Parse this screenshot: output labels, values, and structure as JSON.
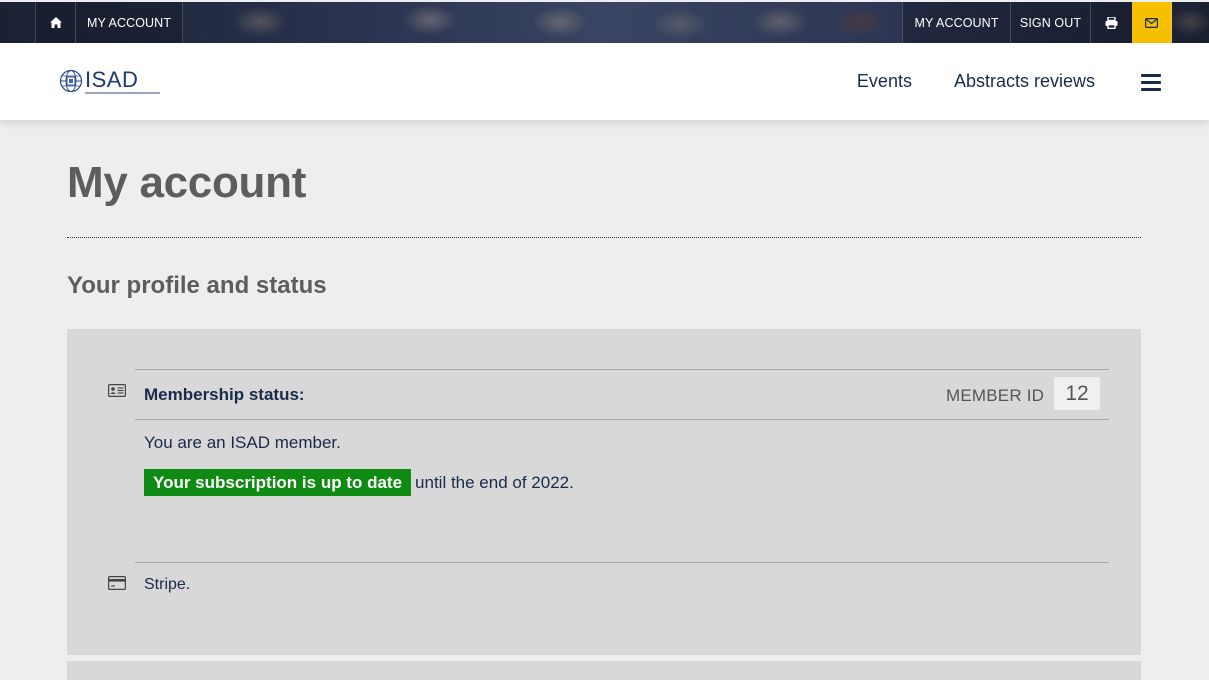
{
  "topbar": {
    "home_icon": "home-icon",
    "left_label": "MY ACCOUNT",
    "my_account": "MY ACCOUNT",
    "sign_out": "SIGN OUT",
    "print_icon": "print-icon",
    "mail_icon": "mail-icon",
    "mail_bg": "#f6c000"
  },
  "header": {
    "logo_text": "ISAD",
    "nav": [
      "Events",
      "Abstracts reviews"
    ],
    "menu_icon": "hamburger-icon"
  },
  "page": {
    "title": "My account",
    "section_title": "Your profile and status"
  },
  "membership": {
    "icon": "id-card-icon",
    "status_label": "Membership status:",
    "member_id_label": "MEMBER ID",
    "member_id": "12",
    "member_text": "You are an ISAD member.",
    "subscription_badge": "Your subscription is up to date",
    "subscription_badge_color": "#0f8a12",
    "subscription_rest": "until the end of 2022."
  },
  "payment": {
    "icon": "credit-card-icon",
    "method": "Stripe."
  }
}
